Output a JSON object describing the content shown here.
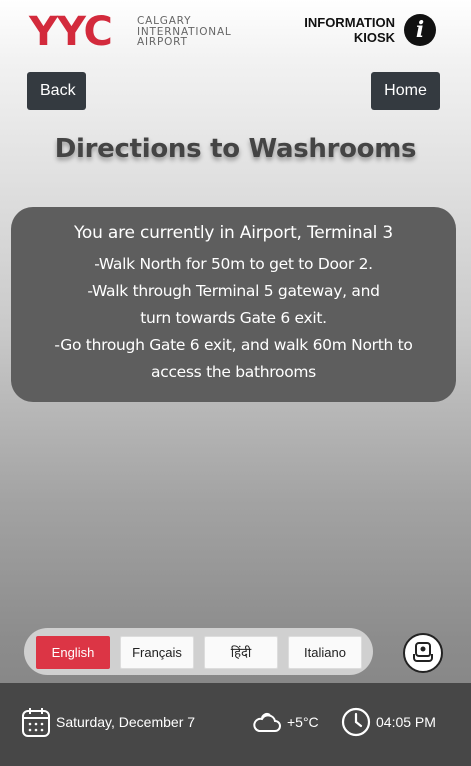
{
  "header": {
    "logo_code": "YYC",
    "logo_lines": [
      "CALGARY",
      "INTERNATIONAL",
      "AIRPORT"
    ],
    "kiosk_lines": [
      "INFORMATION",
      "KIOSK"
    ],
    "info_icon": "info-icon"
  },
  "nav": {
    "back_label": "Back",
    "home_label": "Home"
  },
  "page": {
    "title": "Directions to Washrooms"
  },
  "directions": {
    "location": "You are currently in Airport, Terminal 3",
    "steps": [
      "-Walk North for 50m to get to Door 2.",
      "-Walk through Terminal 5 gateway, and turn towards Gate 6 exit.",
      "-Go through Gate 6 exit, and walk 60m North to access the bathrooms"
    ]
  },
  "languages": {
    "options": [
      "English",
      "Français",
      "हिंदी",
      "Italiano"
    ],
    "selected": "English"
  },
  "accessibility": {
    "icon": "accessibility-seat-icon"
  },
  "footer": {
    "date": "Saturday, December 7",
    "temperature": "+5°C",
    "time": "04:05 PM"
  },
  "colors": {
    "brand_red": "#d32a3c",
    "button_dark": "#343a40",
    "card_bg": "#5e5e5e",
    "active_lang": "#dc3545",
    "footer_bg": "#474747"
  }
}
